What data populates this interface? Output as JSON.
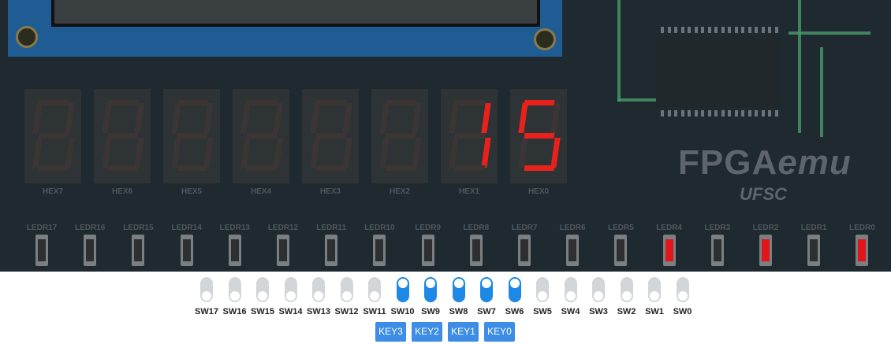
{
  "brand": {
    "name_main": "FPGA",
    "name_italic": "emu",
    "subtitle": "UFSC"
  },
  "colors": {
    "board": "#1e2a30",
    "segment_on": "#e8221b",
    "segment_off": "#3c3536",
    "switch_on": "#1e88e5",
    "switch_off": "#d2d6d9",
    "key": "#3d8de6"
  },
  "hex_displays": [
    {
      "label": "HEX7",
      "digit": ""
    },
    {
      "label": "HEX6",
      "digit": ""
    },
    {
      "label": "HEX5",
      "digit": ""
    },
    {
      "label": "HEX4",
      "digit": ""
    },
    {
      "label": "HEX3",
      "digit": ""
    },
    {
      "label": "HEX2",
      "digit": ""
    },
    {
      "label": "HEX1",
      "digit": "1"
    },
    {
      "label": "HEX0",
      "digit": "5"
    }
  ],
  "leds": [
    {
      "label": "LEDR17",
      "on": false
    },
    {
      "label": "LEDR16",
      "on": false
    },
    {
      "label": "LEDR15",
      "on": false
    },
    {
      "label": "LEDR14",
      "on": false
    },
    {
      "label": "LEDR13",
      "on": false
    },
    {
      "label": "LEDR12",
      "on": false
    },
    {
      "label": "LEDR11",
      "on": false
    },
    {
      "label": "LEDR10",
      "on": false
    },
    {
      "label": "LEDR9",
      "on": false
    },
    {
      "label": "LEDR8",
      "on": false
    },
    {
      "label": "LEDR7",
      "on": false
    },
    {
      "label": "LEDR6",
      "on": false
    },
    {
      "label": "LEDR5",
      "on": false
    },
    {
      "label": "LEDR4",
      "on": true
    },
    {
      "label": "LEDR3",
      "on": false
    },
    {
      "label": "LEDR2",
      "on": true
    },
    {
      "label": "LEDR1",
      "on": false
    },
    {
      "label": "LEDR0",
      "on": true
    }
  ],
  "switches": [
    {
      "label": "SW17",
      "on": false
    },
    {
      "label": "SW16",
      "on": false
    },
    {
      "label": "SW15",
      "on": false
    },
    {
      "label": "SW14",
      "on": false
    },
    {
      "label": "SW13",
      "on": false
    },
    {
      "label": "SW12",
      "on": false
    },
    {
      "label": "SW11",
      "on": false
    },
    {
      "label": "SW10",
      "on": true
    },
    {
      "label": "SW9",
      "on": true
    },
    {
      "label": "SW8",
      "on": true
    },
    {
      "label": "SW7",
      "on": true
    },
    {
      "label": "SW6",
      "on": true
    },
    {
      "label": "SW5",
      "on": false
    },
    {
      "label": "SW4",
      "on": false
    },
    {
      "label": "SW3",
      "on": false
    },
    {
      "label": "SW2",
      "on": false
    },
    {
      "label": "SW1",
      "on": false
    },
    {
      "label": "SW0",
      "on": false
    }
  ],
  "keys": [
    "KEY3",
    "KEY2",
    "KEY1",
    "KEY0"
  ]
}
